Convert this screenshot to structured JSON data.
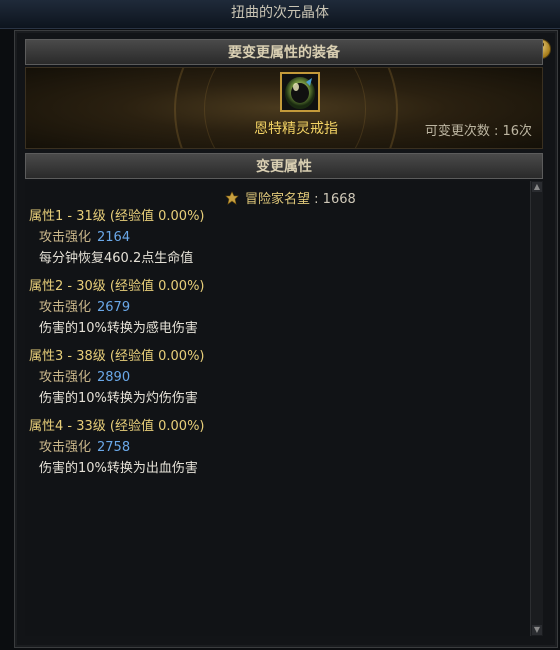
{
  "window": {
    "title": "扭曲的次元晶体"
  },
  "header_equip": {
    "label": "要变更属性的装备"
  },
  "item": {
    "name": "恩特精灵戒指"
  },
  "change_count": {
    "label": "可变更次数 : 16次"
  },
  "header_attr": {
    "label": "变更属性"
  },
  "reputation": {
    "label": "冒险家名望",
    "value": ": 1668"
  },
  "attributes": [
    {
      "title": "属性1 - 31级",
      "exp": "(经验值 0.00%)",
      "stat_label": "攻击强化",
      "stat_value": "2164",
      "desc": "每分钟恢复460.2点生命值"
    },
    {
      "title": "属性2 - 30级",
      "exp": "(经验值 0.00%)",
      "stat_label": "攻击强化",
      "stat_value": "2679",
      "desc": "伤害的10%转换为感电伤害"
    },
    {
      "title": "属性3 - 38级",
      "exp": "(经验值 0.00%)",
      "stat_label": "攻击强化",
      "stat_value": "2890",
      "desc": "伤害的10%转换为灼伤伤害"
    },
    {
      "title": "属性4 - 33级",
      "exp": "(经验值 0.00%)",
      "stat_label": "攻击强化",
      "stat_value": "2758",
      "desc": "伤害的10%转换为出血伤害"
    }
  ],
  "icons": {
    "help": "help-icon",
    "ring": "ring-icon",
    "reputation": "reputation-icon"
  },
  "colors": {
    "accent_gold": "#f2d264",
    "stat_value_blue": "#6aa8e8",
    "attr_title": "#e8cf7a"
  }
}
